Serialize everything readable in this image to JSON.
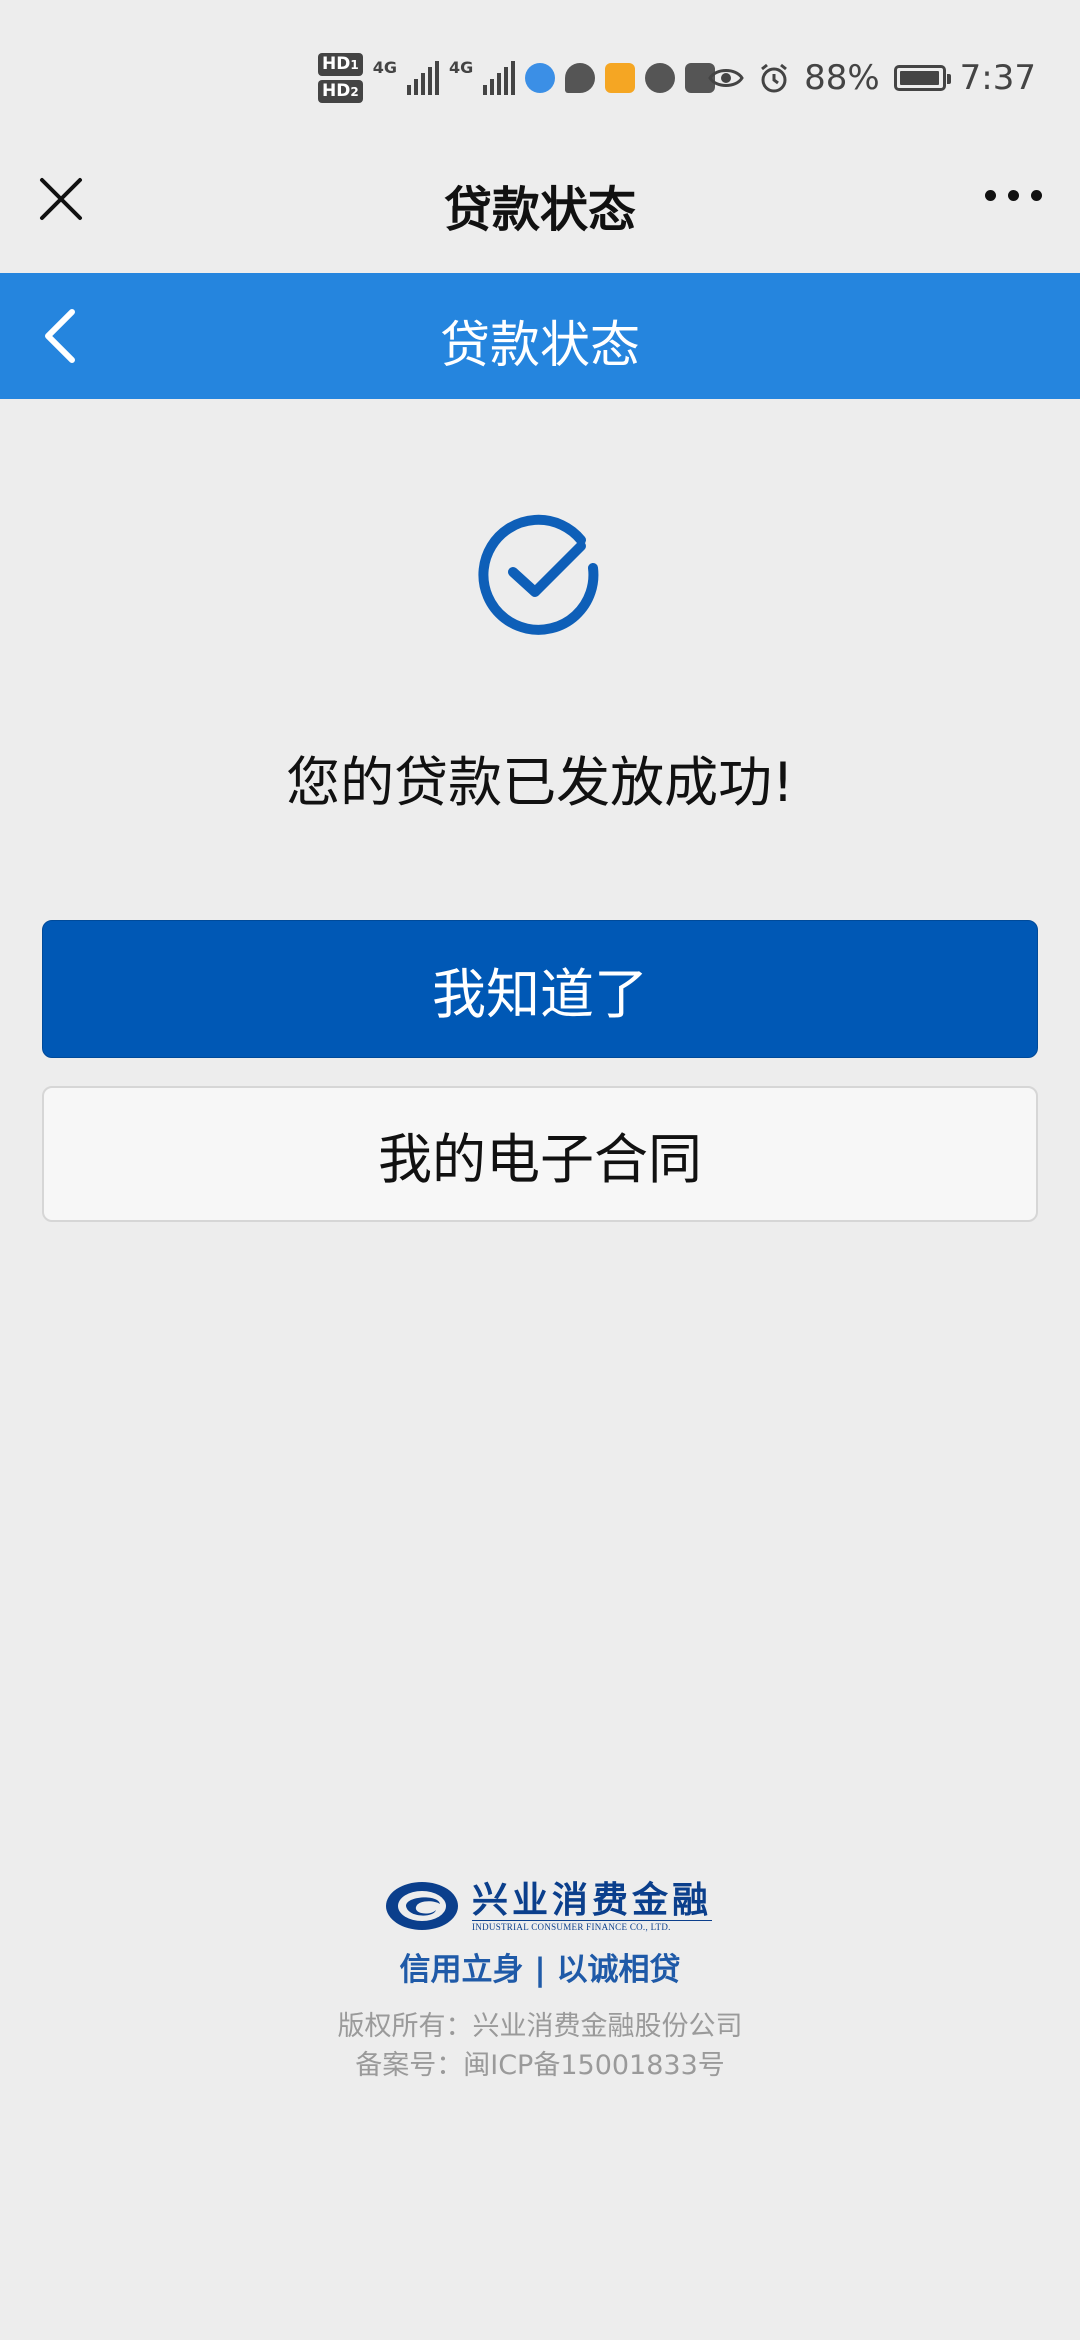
{
  "status_bar": {
    "sim1": "HD",
    "sim1_index": "1",
    "sim2": "HD",
    "sim2_index": "2",
    "network1": "4G",
    "network2": "4G",
    "battery_percent": "88%",
    "time": "7:37",
    "icons": [
      "eye-icon",
      "alarm-icon",
      "battery-icon"
    ]
  },
  "title_bar": {
    "title": "贷款状态",
    "close_icon": "close-icon",
    "more_icon": "more-icon"
  },
  "header": {
    "title": "贷款状态",
    "back_icon": "chevron-left-icon",
    "background_color": "#2585de"
  },
  "main": {
    "status_icon": "check-circle-icon",
    "message": "您的贷款已发放成功!",
    "primary_button": "我知道了",
    "secondary_button": "我的电子合同",
    "accent_color": "#0058b5"
  },
  "footer": {
    "logo_cn": "兴业消费金融",
    "logo_en": "INDUSTRIAL CONSUMER FINANCE CO., LTD.",
    "slogan": "信用立身 | 以诚相贷",
    "copyright": "版权所有：兴业消费金融股份公司",
    "icp": "备案号：闽ICP备15001833号"
  }
}
